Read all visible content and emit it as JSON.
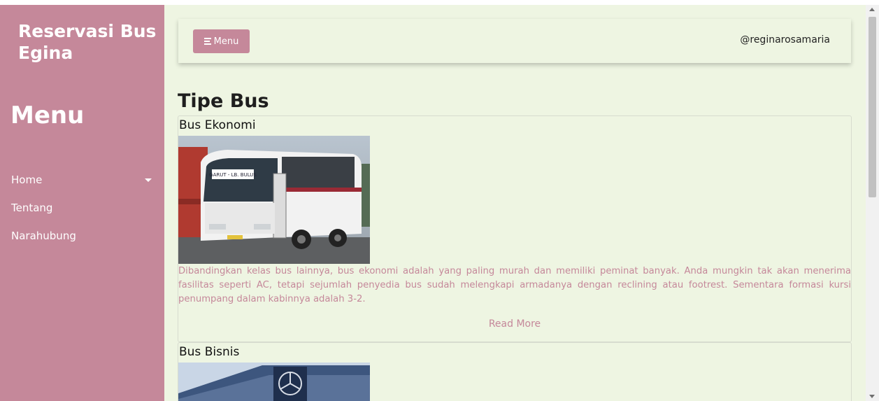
{
  "sidebar": {
    "brand": "Reservasi Bus Egina",
    "menu_heading": "Menu",
    "items": [
      {
        "label": "Home",
        "has_dropdown": true
      },
      {
        "label": "Tentang"
      },
      {
        "label": "Narahubung"
      }
    ]
  },
  "topbar": {
    "menu_button": "Menu",
    "menu_icon": "hamburger-icon",
    "username": "@reginarosamaria"
  },
  "content": {
    "title": "Tipe Bus",
    "cards": [
      {
        "title": "Bus Ekonomi",
        "description": "Dibandingkan kelas bus lainnya, bus ekonomi adalah yang paling murah dan memiliki peminat banyak. Anda mungkin tak akan menerima fasilitas seperti AC, tetapi sejumlah penyedia bus sudah melengkapi armadanya dengan reclining atau footrest. Sementara formasi kursi penumpang dalam kabinnya adalah 3-2.",
        "read_more": "Read More",
        "sign_text": "GARUT - LB. BULUS"
      },
      {
        "title": "Bus Bisnis"
      }
    ]
  },
  "colors": {
    "sidebar": "#c5889a",
    "main_background": "#eef5e2",
    "accent_text": "#c5889a"
  }
}
